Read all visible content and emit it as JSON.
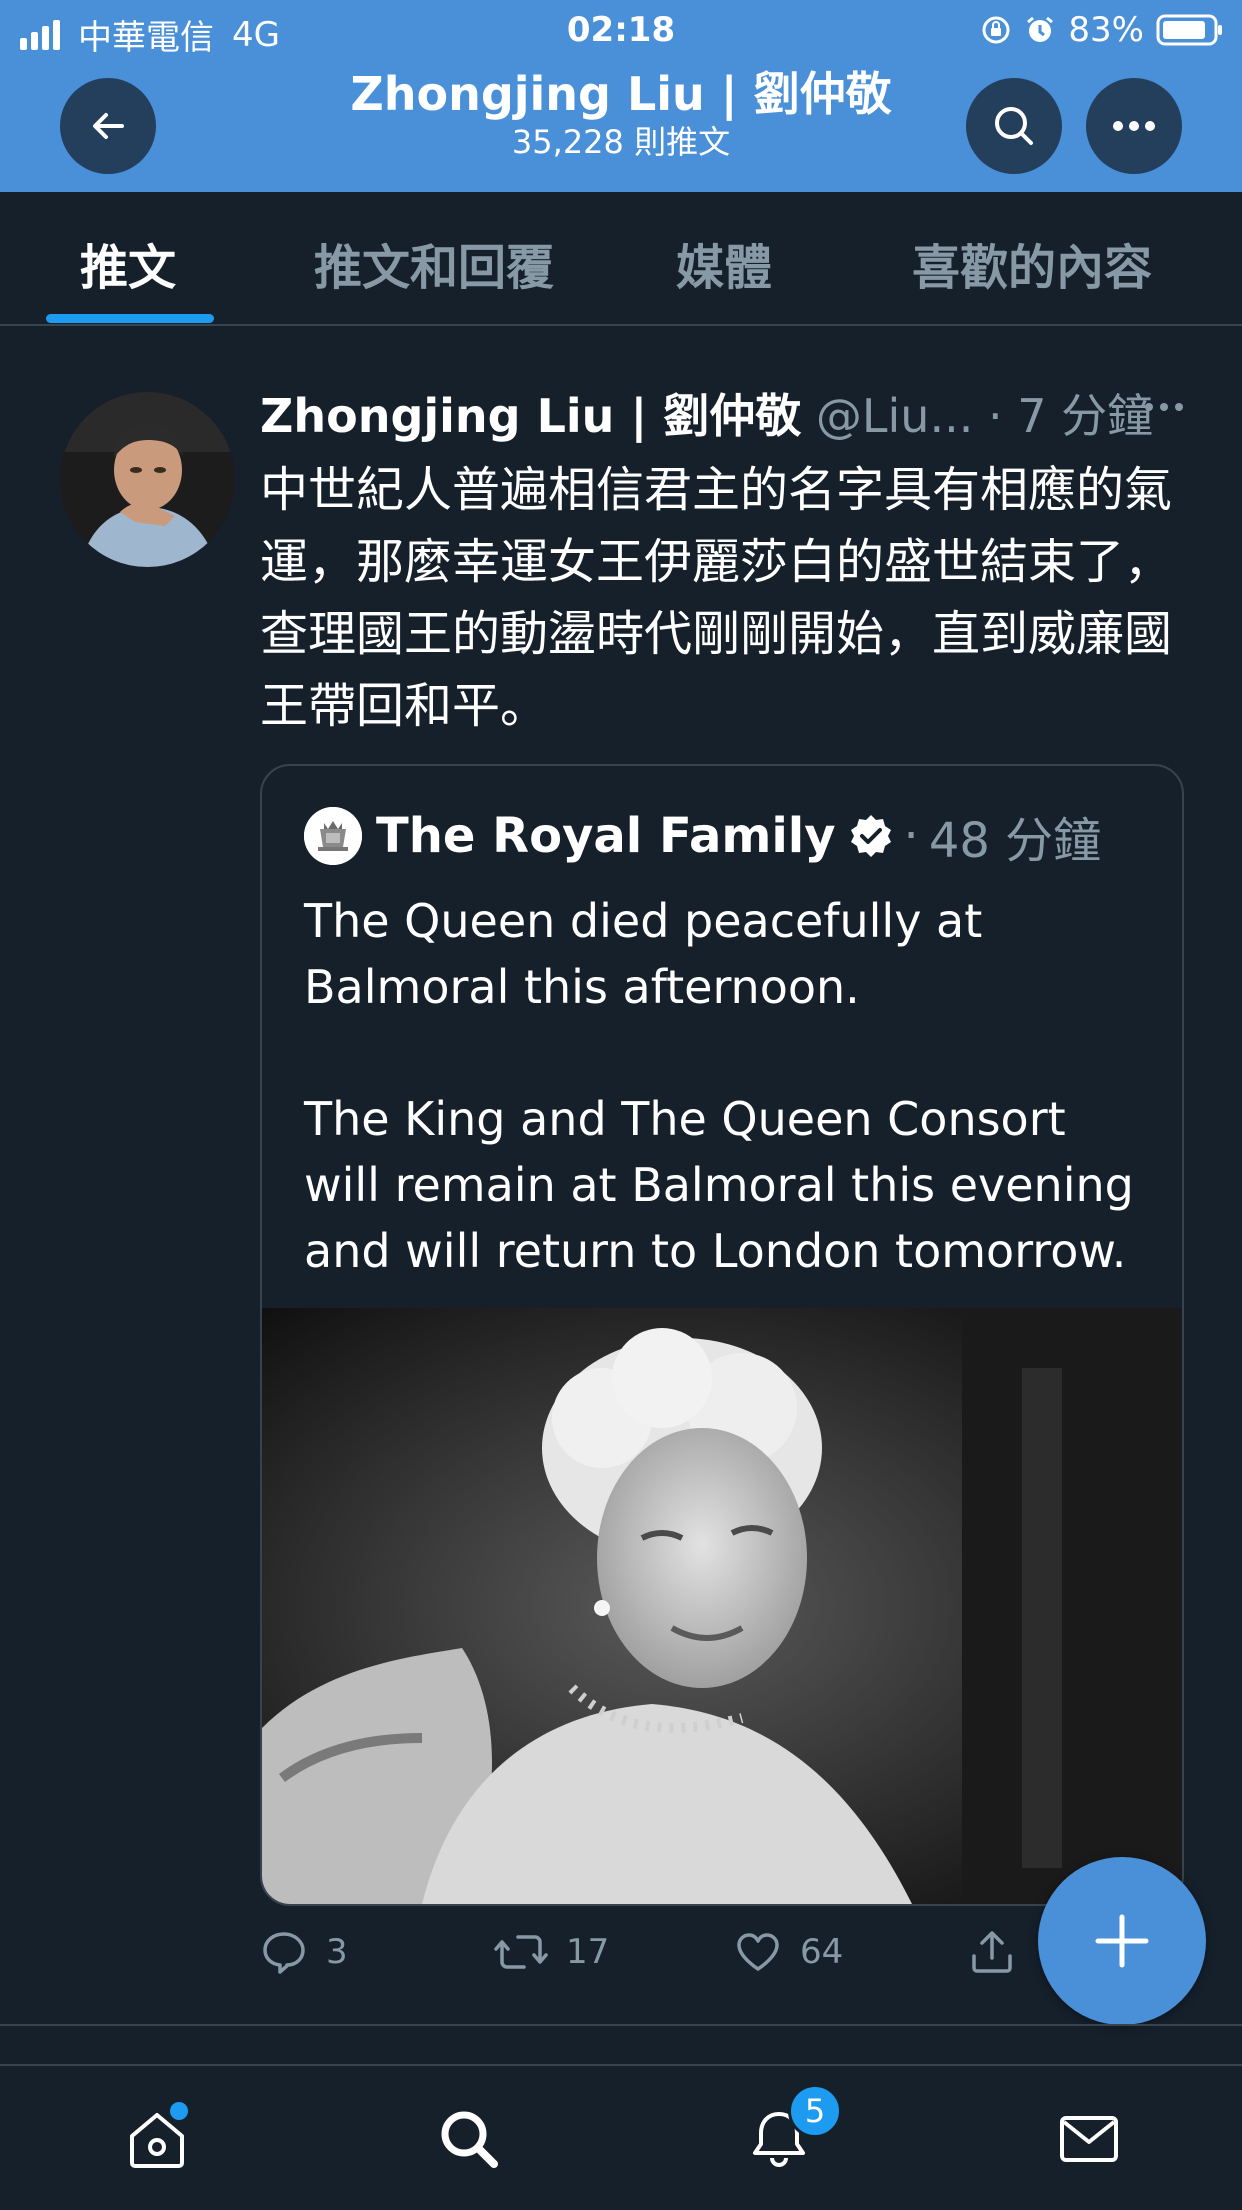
{
  "status_bar": {
    "carrier": "中華電信",
    "network": "4G",
    "time": "02:18",
    "battery": "83%"
  },
  "header": {
    "title": "Zhongjing Liu | 劉仲敬",
    "subtitle": "35,228 則推文",
    "back_icon": "arrow-left-icon",
    "search_icon": "search-icon",
    "more_icon": "more-horizontal-icon",
    "background": "#4a90d9"
  },
  "tabs": [
    {
      "label": "推文",
      "active": true
    },
    {
      "label": "推文和回覆",
      "active": false
    },
    {
      "label": "媒體",
      "active": false
    },
    {
      "label": "喜歡的內容",
      "active": false
    }
  ],
  "tweet": {
    "author_name": "Zhongjing Liu | 劉仲敬",
    "handle": "@Liu...",
    "separator": "·",
    "time": "7 分鐘",
    "text": "中世紀人普遍相信君主的名字具有相應的氣運，那麼幸運女王伊麗莎白的盛世結束了，查理國王的動盪時代剛剛開始，直到威廉國王帶回和平。",
    "quote": {
      "author_name": "The Royal Family",
      "verified": true,
      "separator": "·",
      "time": "48 分鐘",
      "text_line1": "The Queen died peacefully at Balmoral this afternoon.",
      "text_line2": "The King and The Queen Consort will remain at Balmoral this evening and will return to London tomorrow."
    },
    "actions": {
      "replies": "3",
      "retweets": "17",
      "likes": "64"
    }
  },
  "bottom_nav": {
    "items": [
      "home-icon",
      "search-icon",
      "notifications-icon",
      "messages-icon"
    ],
    "notification_count": "5"
  },
  "colors": {
    "background": "#15202b",
    "accent": "#1d9bf0",
    "secondary_text": "#8899a6",
    "border": "#38444d"
  }
}
